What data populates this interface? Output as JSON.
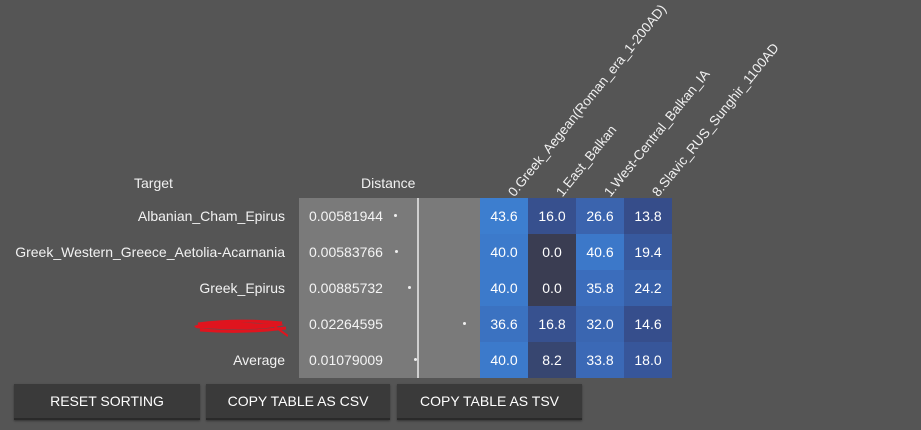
{
  "headers": {
    "target": "Target",
    "distance": "Distance",
    "columns": [
      "0.Greek_Aegean(Roman_era_1-200AD)",
      "1.East_Balkan",
      "1.West-Central_Balkan_IA",
      "8.Slavic_RUS_Sunghir_1100AD"
    ]
  },
  "rows": [
    {
      "target": "Albanian_Cham_Epirus",
      "distance": "0.00581944",
      "values": [
        "43.6",
        "16.0",
        "26.6",
        "13.8"
      ],
      "colors": [
        "#3d7ecf",
        "#37508e",
        "#3b64ae",
        "#364d8a"
      ]
    },
    {
      "target": "Greek_Western_Greece_Aetolia-Acarnania",
      "distance": "0.00583766",
      "values": [
        "40.0",
        "0.0",
        "40.6",
        "19.4"
      ],
      "colors": [
        "#3c7acb",
        "#3a3d52",
        "#3c78c9",
        "#37599e"
      ]
    },
    {
      "target": "Greek_Epirus",
      "distance": "0.00885732",
      "values": [
        "40.0",
        "0.0",
        "35.8",
        "24.2"
      ],
      "colors": [
        "#3c7acb",
        "#3a3d52",
        "#3b6dbc",
        "#3860a8"
      ]
    },
    {
      "target": "",
      "distance": "0.02264595",
      "values": [
        "36.6",
        "16.8",
        "32.0",
        "14.6"
      ],
      "colors": [
        "#3b72c1",
        "#37518f",
        "#3a66b1",
        "#364e8c"
      ]
    },
    {
      "target": "Average",
      "distance": "0.01079009",
      "values": [
        "40.0",
        "8.2",
        "33.8",
        "18.0"
      ],
      "colors": [
        "#3c7acb",
        "#374670",
        "#3b69b6",
        "#37569a"
      ]
    }
  ],
  "buttons": {
    "reset_sorting": "RESET SORTING",
    "copy_csv": "COPY TABLE AS CSV",
    "copy_tsv": "COPY TABLE AS TSV"
  },
  "colors": {
    "background": "#555555",
    "distance_panel": "#7a7a7a",
    "button": "#3a3a3a",
    "redaction": "#e0141e"
  }
}
